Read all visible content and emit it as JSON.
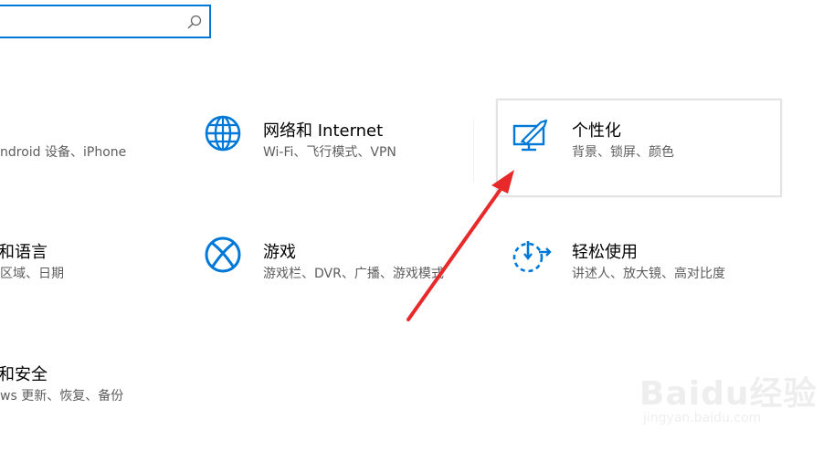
{
  "search": {
    "placeholder": ""
  },
  "tiles": [
    {
      "title": "",
      "sub": "ndroid 设备、iPhone"
    },
    {
      "title": "网络和 Internet",
      "sub": "Wi-Fi、飞行模式、VPN"
    },
    {
      "title": "个性化",
      "sub": "背景、锁屏、颜色"
    },
    {
      "title": "和语言",
      "sub": "区域、日期"
    },
    {
      "title": "游戏",
      "sub": "游戏栏、DVR、广播、游戏模式"
    },
    {
      "title": "轻松使用",
      "sub": "讲述人、放大镜、高对比度"
    },
    {
      "title": "和安全",
      "sub": "ws 更新、恢复、备份"
    }
  ],
  "watermark": {
    "brand": "Baidu经验",
    "url": "jingyan.baidu.com"
  },
  "colors": {
    "accent": "#0078d7",
    "arrow": "#e8292a"
  }
}
